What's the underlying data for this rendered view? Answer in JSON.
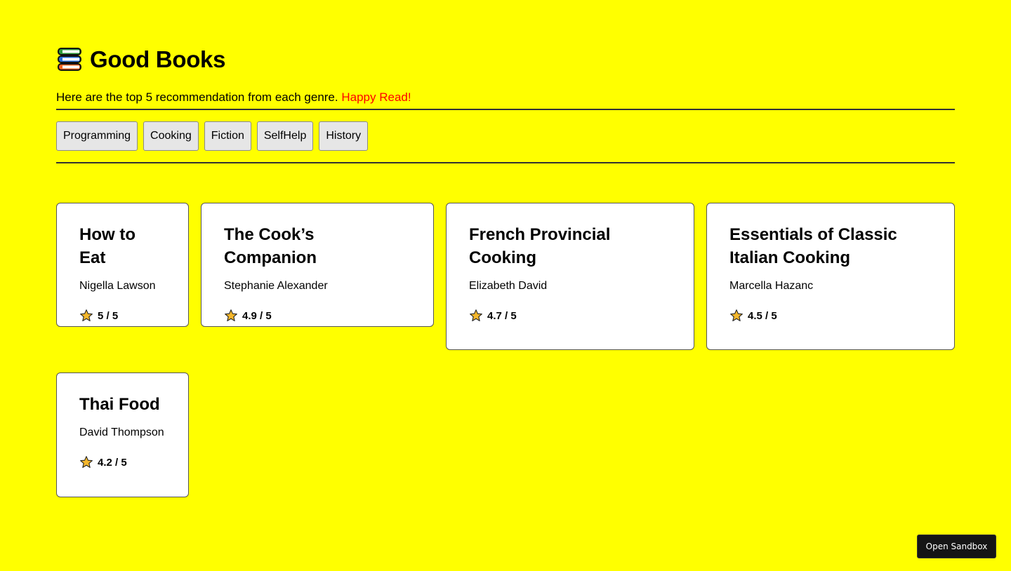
{
  "app": {
    "title": "Good Books",
    "logo_icon": "books-stack-icon"
  },
  "tagline": {
    "text": "Here are the top 5 recommendation from each genre.",
    "accent": "Happy Read!",
    "accent_color": "#ff0000"
  },
  "colors": {
    "background": "#ffff00",
    "button_bg": "#e6e6e6",
    "card_bg": "#ffffff"
  },
  "genres": [
    {
      "label": "Programming"
    },
    {
      "label": "Cooking"
    },
    {
      "label": "Fiction"
    },
    {
      "label": "SelfHelp"
    },
    {
      "label": "History"
    }
  ],
  "books": [
    {
      "title": "How to Eat",
      "author": "Nigella Lawson",
      "rating": "5 / 5"
    },
    {
      "title": "The Cook’s Companion",
      "author": "Stephanie Alexander",
      "rating": "4.9 / 5"
    },
    {
      "title": "French Provincial Cooking",
      "author": "Elizabeth David",
      "rating": "4.7 / 5"
    },
    {
      "title": "Essentials of Classic Italian Cooking",
      "author": "Marcella Hazanc",
      "rating": "4.5 / 5"
    },
    {
      "title": "Thai Food",
      "author": "David Thompson",
      "rating": "4.2 / 5"
    }
  ],
  "sandbox": {
    "label": "Open Sandbox"
  }
}
